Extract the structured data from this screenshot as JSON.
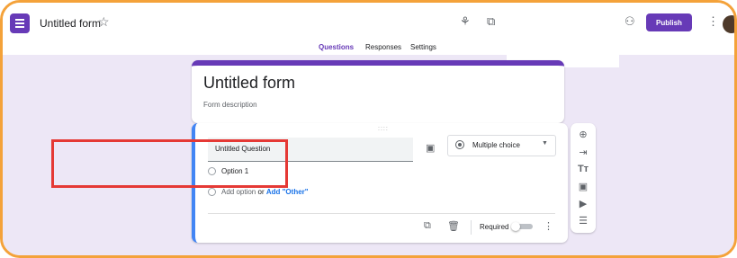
{
  "header": {
    "app_icon": "forms-icon",
    "title": "Untitled form",
    "star_icon": "star-icon",
    "customize_icon": "palette-icon",
    "preview_icon": "preview-icon",
    "share_icon": "add-person-icon",
    "publish_label": "Publish",
    "more_icon": "more-vert-icon"
  },
  "tabs": {
    "questions": "Questions",
    "responses": "Responses",
    "settings": "Settings"
  },
  "form": {
    "title": "Untitled form",
    "description": "Form description"
  },
  "question": {
    "drag_handle": "::::",
    "title": "Untitled Question",
    "type": "Multiple choice",
    "options": [
      "Option 1"
    ],
    "add_option": "Add option",
    "or": "or",
    "add_other": "Add \"Other\"",
    "required_label": "Required"
  },
  "side_toolbar": [
    "add-question-icon",
    "import-question-icon",
    "add-title-icon",
    "add-image-icon",
    "add-video-icon",
    "add-section-icon"
  ],
  "colors": {
    "accent": "#673ab7",
    "canvas": "#ede7f6",
    "question_border": "#4285f4",
    "highlight": "#e53935",
    "frame": "#f4a23a"
  }
}
